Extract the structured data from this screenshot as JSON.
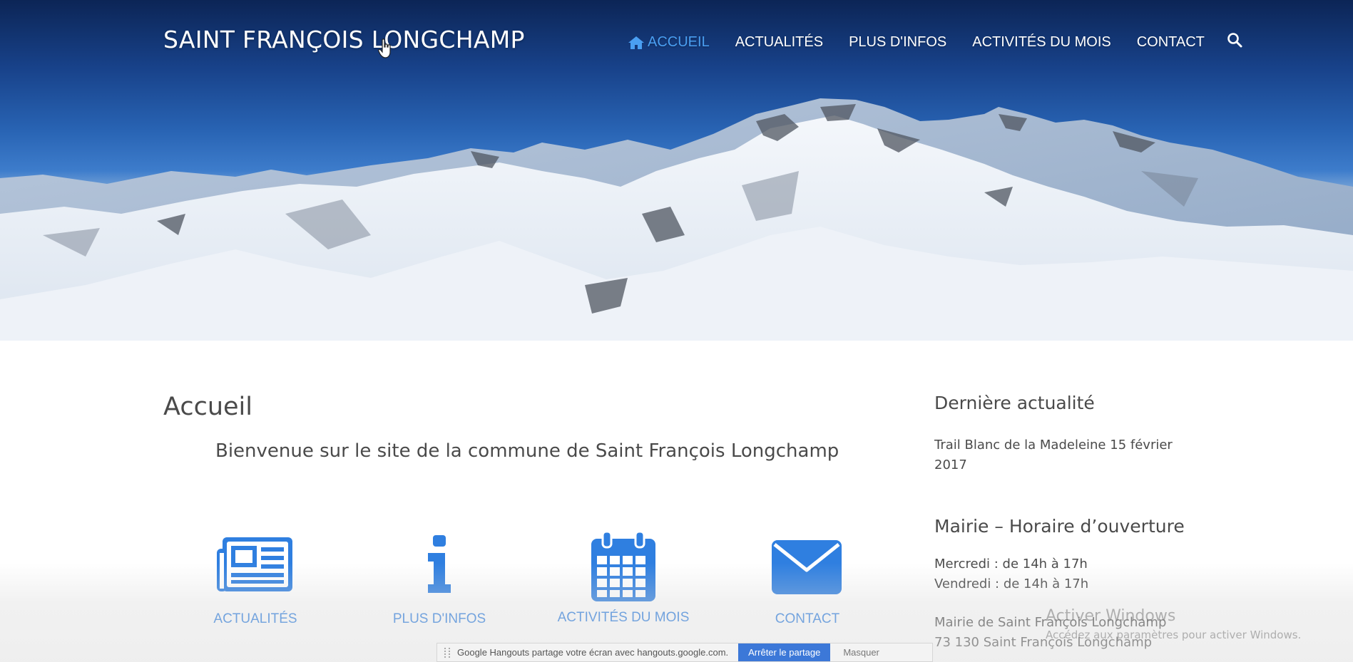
{
  "header": {
    "site_title": "SAINT FRANÇOIS LONGCHAMP",
    "nav": [
      {
        "label": "ACCUEIL",
        "active": true,
        "icon": "home-icon"
      },
      {
        "label": "ACTUALITÉS",
        "active": false
      },
      {
        "label": "PLUS D'INFOS",
        "active": false
      },
      {
        "label": "ACTIVITÉS DU MOIS",
        "active": false
      },
      {
        "label": "CONTACT",
        "active": false
      }
    ],
    "search_icon": "search-icon"
  },
  "main": {
    "page_title": "Accueil",
    "welcome": "Bienvenue sur le site de la commune de Saint François Longchamp",
    "tiles": [
      {
        "label": "ACTUALITÉS",
        "icon": "newspaper-icon"
      },
      {
        "label": "PLUS D'INFOS",
        "icon": "info-icon"
      },
      {
        "label": "ACTIVITÉS DU MOIS",
        "icon": "calendar-icon"
      },
      {
        "label": "CONTACT",
        "icon": "envelope-icon"
      }
    ]
  },
  "sidebar": {
    "latest_news_heading": "Dernière actualité",
    "latest_news_link": "Trail Blanc de la Madeleine",
    "latest_news_date_line1": "15 février",
    "latest_news_date_line2": "2017",
    "hours_heading": "Mairie – Horaire d’ouverture",
    "hours": [
      "Mercredi : de 14h à 17h",
      "Vendredi : de 14h à 17h"
    ],
    "address_line1": "Mairie de Saint François Longchamp",
    "address_line2": "73 130 Saint François Longchamp"
  },
  "overlays": {
    "windows_activate_title": "Activer Windows",
    "windows_activate_sub": "Accédez aux paramètres pour activer Windows.",
    "hangouts_text": "Google Hangouts partage votre écran avec hangouts.google.com.",
    "hangouts_stop": "Arrêter le partage",
    "hangouts_hide": "Masquer"
  },
  "colors": {
    "accent": "#2f7fe0",
    "nav_active": "#4a9ff2",
    "text": "#4a4a4a",
    "sky_top": "#0c2556"
  }
}
